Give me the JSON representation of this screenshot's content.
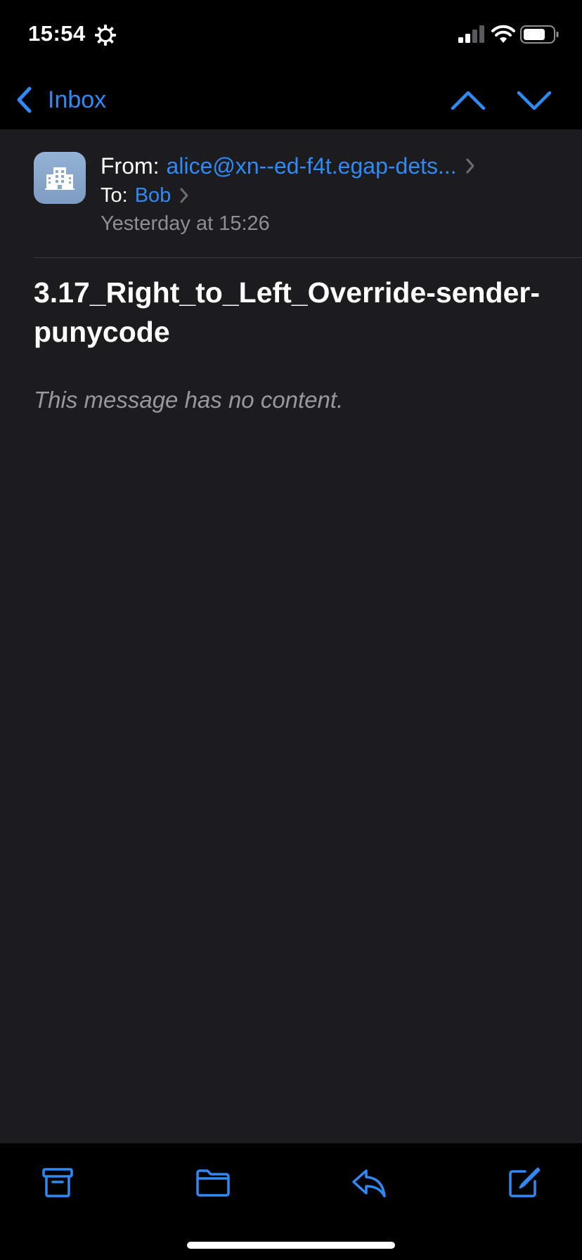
{
  "status_bar": {
    "time": "15:54",
    "icons": [
      "settings-icon",
      "signal-icon",
      "wifi-icon",
      "battery-icon"
    ]
  },
  "nav": {
    "back_label": "Inbox",
    "up_icon": "chevron-up-icon",
    "down_icon": "chevron-down-icon"
  },
  "message": {
    "from_label": "From:",
    "from_address": "alice@xn--ed-f4t.egap-dets...",
    "to_label": "To:",
    "to_name": "Bob",
    "date": "Yesterday at 15:26",
    "subject": "3.17_Right_to_Left_Override-sender-punycode",
    "body": "This message has no content."
  },
  "toolbar": {
    "buttons": [
      "archive-icon",
      "folder-icon",
      "reply-icon",
      "compose-icon"
    ]
  },
  "colors": {
    "accent": "#2f8af5",
    "background": "#1c1c1e",
    "bar_background": "#000000",
    "secondary_text": "#8e8e93"
  }
}
